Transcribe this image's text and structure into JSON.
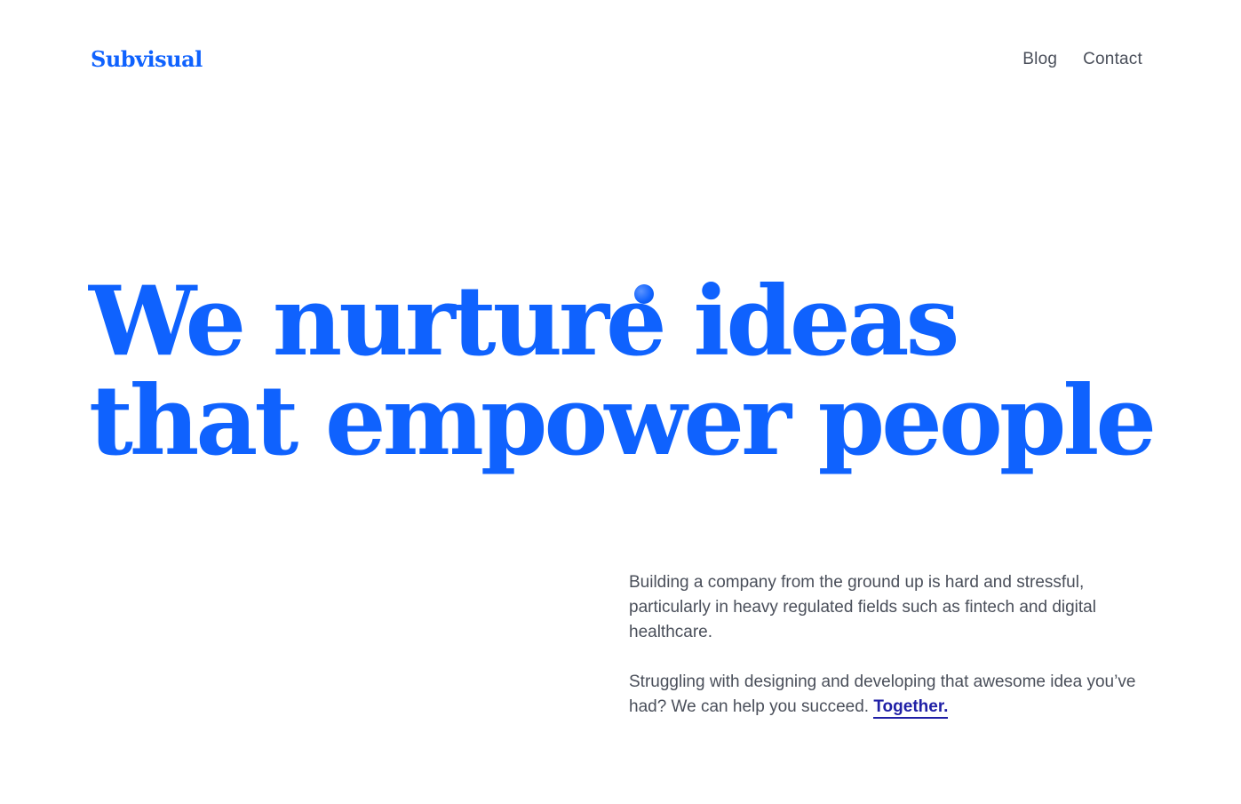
{
  "header": {
    "logo": "Subvisual",
    "nav": [
      {
        "label": "Blog"
      },
      {
        "label": "Contact"
      }
    ]
  },
  "hero": {
    "line1": "We nurture ideas",
    "line2": "that empower people"
  },
  "intro": {
    "paragraph1": "Building a company from the ground up is hard and stressful, particularly in heavy regulated fields such as fintech and digital healthcare.",
    "paragraph2": "Struggling with designing and developing that awesome idea you’ve had? We can help you succeed.",
    "link": "Together."
  },
  "colors": {
    "brand": "#0f62fe",
    "text": "#4a4f5a",
    "link": "#1f1fa6"
  }
}
